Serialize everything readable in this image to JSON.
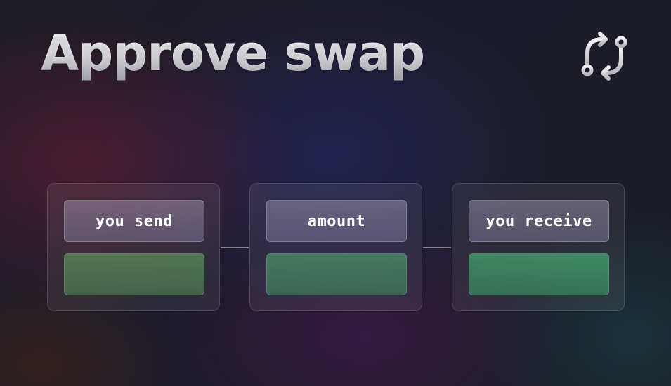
{
  "header": {
    "title": "Approve swap",
    "icon": "swap-arrows-icon"
  },
  "steps": [
    {
      "label": "you send",
      "value": ""
    },
    {
      "label": "amount",
      "value": ""
    },
    {
      "label": "you receive",
      "value": ""
    }
  ],
  "colors": {
    "value_field": "#4a9a6e",
    "label_field": "#8a82a0",
    "connector": "#8b8696"
  }
}
